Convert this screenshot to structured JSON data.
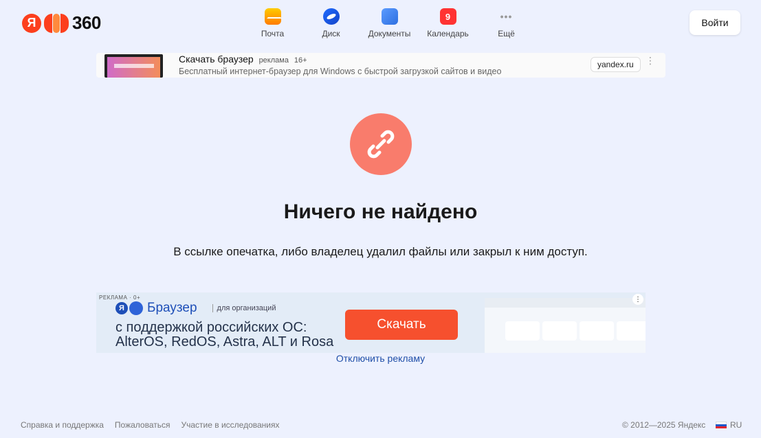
{
  "header": {
    "logo_letter": "Я",
    "logo_number": "360",
    "nav": [
      {
        "label": "Почта",
        "icon": "mail-icon"
      },
      {
        "label": "Диск",
        "icon": "disk-icon"
      },
      {
        "label": "Документы",
        "icon": "docs-icon"
      },
      {
        "label": "Календарь",
        "icon": "calendar-icon",
        "badge": "9"
      },
      {
        "label": "Ещё",
        "icon": "more-icon",
        "glyph": "•••"
      }
    ],
    "login_label": "Войти"
  },
  "top_ad": {
    "title": "Скачать браузер",
    "tag": "реклама",
    "age": "16+",
    "subtitle": "Бесплатный интернет-браузер для Windows с быстрой загрузкой сайтов и видео",
    "domain": "yandex.ru",
    "menu_glyph": "⋮"
  },
  "main": {
    "icon": "broken-link-icon",
    "title": "Ничего не найдено",
    "description": "В ссылке опечатка, либо владелец удалил файлы или закрыл к ним доступ."
  },
  "banner": {
    "ad_tag": "РЕКЛАМА · 0+",
    "logo_letter": "Я",
    "brand": "Браузер",
    "org": "для организаций",
    "line1": "с поддержкой российских ОС:",
    "line2": "AlterOS, RedOS, Astra, ALT и Rosa",
    "button": "Скачать",
    "menu_glyph": "⋮"
  },
  "disable_ads": "Отключить рекламу",
  "footer": {
    "links": [
      "Справка и поддержка",
      "Пожаловаться",
      "Участие в исследованиях"
    ],
    "copyright": "© 2012—2025 Яндекс",
    "lang": "RU"
  },
  "colors": {
    "background": "#edf1fe",
    "accent_red": "#fc3f1d",
    "error_circle": "#f97c6c",
    "download_button": "#f6502e",
    "link": "#1f4ea8"
  }
}
